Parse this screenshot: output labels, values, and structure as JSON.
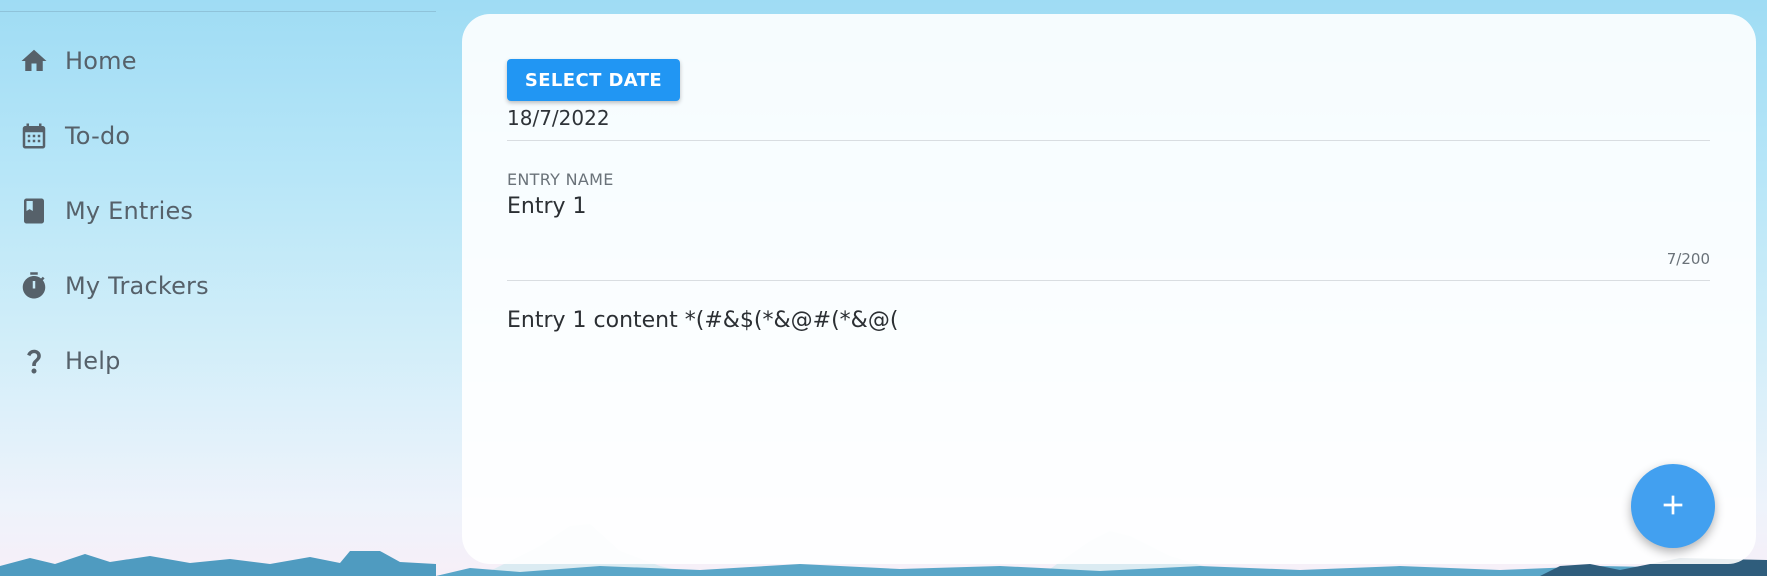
{
  "sidebar": {
    "items": [
      {
        "label": "Home",
        "icon": "home-icon"
      },
      {
        "label": "To-do",
        "icon": "calendar-icon"
      },
      {
        "label": "My Entries",
        "icon": "book-icon"
      },
      {
        "label": "My Trackers",
        "icon": "stopwatch-icon"
      },
      {
        "label": "Help",
        "icon": "help-icon"
      }
    ]
  },
  "main": {
    "select_date_label": "SELECT DATE",
    "date_value": "18/7/2022",
    "entry_name_label": "ENTRY NAME",
    "entry_name_value": "Entry 1",
    "char_counter": "7/200",
    "content_value": "Entry 1 content *(#&$(*&@#(*&@(",
    "fab_icon": "plus-icon"
  },
  "colors": {
    "accent": "#2196f3",
    "fab": "#42a0f0",
    "nav_text": "#56616a",
    "nav_icon": "#56616a"
  }
}
